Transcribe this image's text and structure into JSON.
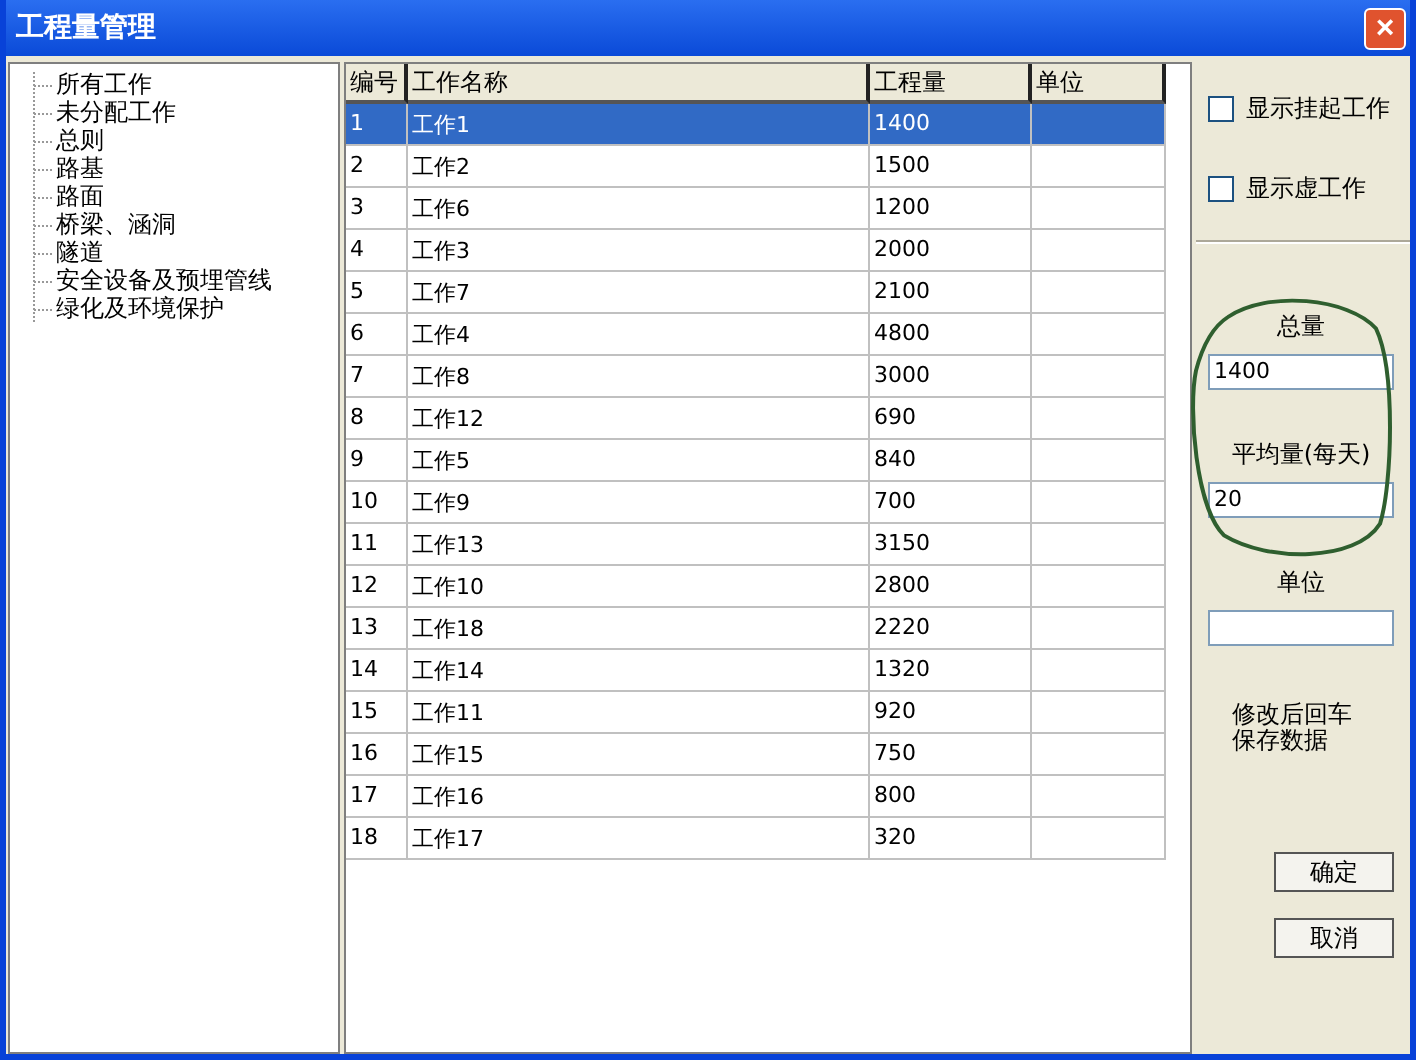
{
  "window": {
    "title": "工程量管理",
    "close": "×"
  },
  "tree": {
    "items": [
      {
        "label": "所有工作"
      },
      {
        "label": "未分配工作"
      },
      {
        "label": "总则"
      },
      {
        "label": "路基"
      },
      {
        "label": "路面"
      },
      {
        "label": "桥梁、涵洞"
      },
      {
        "label": "隧道"
      },
      {
        "label": "安全设备及预埋管线"
      },
      {
        "label": "绿化及环境保护"
      }
    ]
  },
  "table": {
    "columns": [
      "编号",
      "工作名称",
      "工程量",
      "单位"
    ],
    "rows": [
      {
        "cells": [
          "1",
          "工作1",
          "1400",
          ""
        ],
        "selected": true
      },
      {
        "cells": [
          "2",
          "工作2",
          "1500",
          ""
        ],
        "selected": false
      },
      {
        "cells": [
          "3",
          "工作6",
          "1200",
          ""
        ],
        "selected": false
      },
      {
        "cells": [
          "4",
          "工作3",
          "2000",
          ""
        ],
        "selected": false
      },
      {
        "cells": [
          "5",
          "工作7",
          "2100",
          ""
        ],
        "selected": false
      },
      {
        "cells": [
          "6",
          "工作4",
          "4800",
          ""
        ],
        "selected": false
      },
      {
        "cells": [
          "7",
          "工作8",
          "3000",
          ""
        ],
        "selected": false
      },
      {
        "cells": [
          "8",
          "工作12",
          "690",
          ""
        ],
        "selected": false
      },
      {
        "cells": [
          "9",
          "工作5",
          "840",
          ""
        ],
        "selected": false
      },
      {
        "cells": [
          "10",
          "工作9",
          "700",
          ""
        ],
        "selected": false
      },
      {
        "cells": [
          "11",
          "工作13",
          "3150",
          ""
        ],
        "selected": false
      },
      {
        "cells": [
          "12",
          "工作10",
          "2800",
          ""
        ],
        "selected": false
      },
      {
        "cells": [
          "13",
          "工作18",
          "2220",
          ""
        ],
        "selected": false
      },
      {
        "cells": [
          "14",
          "工作14",
          "1320",
          ""
        ],
        "selected": false
      },
      {
        "cells": [
          "15",
          "工作11",
          "920",
          ""
        ],
        "selected": false
      },
      {
        "cells": [
          "16",
          "工作15",
          "750",
          ""
        ],
        "selected": false
      },
      {
        "cells": [
          "17",
          "工作16",
          "800",
          ""
        ],
        "selected": false
      },
      {
        "cells": [
          "18",
          "工作17",
          "320",
          ""
        ],
        "selected": false
      }
    ]
  },
  "options": [
    {
      "label": "显示挂起工作",
      "checked": false
    },
    {
      "label": "显示虚工作",
      "checked": false
    }
  ],
  "fields": [
    {
      "label": "总量",
      "value": "1400"
    },
    {
      "label": "平均量(每天)",
      "value": "20"
    },
    {
      "label": "单位"
    }
  ],
  "note": [
    "修改后回车",
    "保存数据"
  ],
  "buttons": [
    "确定",
    "取消"
  ]
}
